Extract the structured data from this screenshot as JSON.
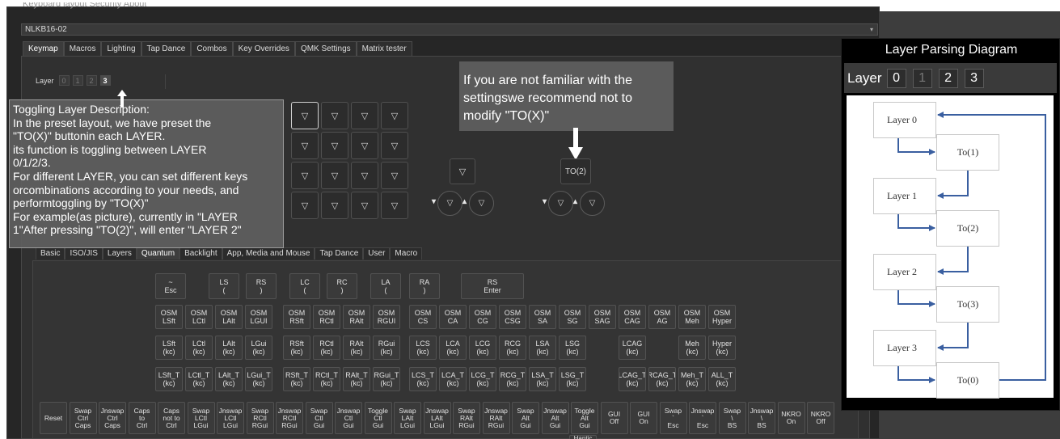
{
  "app": {
    "menu": "Keyboard layout  Security  About",
    "device": "NLKB16-02",
    "main_tabs": [
      "Keymap",
      "Macros",
      "Lighting",
      "Tap Dance",
      "Combos",
      "Key Overrides",
      "QMK Settings",
      "Matrix tester"
    ],
    "active_main_tab": "Keymap"
  },
  "layers": {
    "label": "Layer",
    "buttons": [
      "0",
      "1",
      "2",
      "3"
    ],
    "active": "3"
  },
  "keyboard": {
    "grid_glyph": "▽",
    "encoder_key": "▽",
    "to_key_label": "TO(2)",
    "knob_glyph": "▽",
    "knob_left_arrow": "▾",
    "knob_right_arrow": "▴"
  },
  "annotations": {
    "toggle_desc": [
      "Toggling Layer Description:",
      "In the preset layout, we have preset the",
      "\"TO(X)\"  buttonin each LAYER.",
      "its function is toggling between LAYER",
      "0/1/2/3.",
      "For different LAYER, you can set different keys",
      "orcombinations according to your needs, and",
      "performtoggling by \"TO(X)\"",
      "For example(as picture), currently in \"LAYER",
      "1\"After pressing \"TO(2)\", will enter \"LAYER 2\""
    ],
    "advice": [
      "If you are not familiar with the",
      "settingswe recommend not to",
      "modify \"TO(X)\""
    ]
  },
  "sub_tabs": [
    "Basic",
    "ISO/JIS",
    "Layers",
    "Quantum",
    "Backlight",
    "App, Media and Mouse",
    "Tap Dance",
    "User",
    "Macro"
  ],
  "active_sub_tab": "Quantum",
  "quantum_rows": {
    "row0": [
      "~\nEsc",
      "LS\n(",
      "RS\n)",
      "LC\n(",
      "RC\n)",
      "LA\n(",
      "RA\n)",
      "RS\nEnter"
    ],
    "row1": [
      "OSM\nLSft",
      "OSM\nLCtl",
      "OSM\nLAlt",
      "OSM\nLGUI",
      "OSM\nRSft",
      "OSM\nRCtl",
      "OSM\nRAlt",
      "OSM\nRGUI",
      "OSM\nCS",
      "OSM\nCA",
      "OSM\nCG",
      "OSM\nCSG",
      "OSM\nSA",
      "OSM\nSG",
      "OSM\nSAG",
      "OSM\nCAG",
      "OSM\nAG",
      "OSM\nMeh",
      "OSM\nHyper"
    ],
    "row2": [
      "LSft\n(kc)",
      "LCtl\n(kc)",
      "LAlt\n(kc)",
      "LGui\n(kc)",
      "RSft\n(kc)",
      "RCtl\n(kc)",
      "RAlt\n(kc)",
      "RGui\n(kc)",
      "LCS\n(kc)",
      "LCA\n(kc)",
      "LCG\n(kc)",
      "RCG\n(kc)",
      "LSA\n(kc)",
      "LSG\n(kc)",
      "LCAG\n(kc)",
      "Meh\n(kc)",
      "Hyper\n(kc)"
    ],
    "row3": [
      "LSft_T\n(kc)",
      "LCtl_T\n(kc)",
      "LAlt_T\n(kc)",
      "LGui_T\n(kc)",
      "RSft_T\n(kc)",
      "RCtl_T\n(kc)",
      "RAlt_T\n(kc)",
      "RGui_T\n(kc)",
      "LCS_T\n(kc)",
      "LCA_T\n(kc)",
      "LCG_T\n(kc)",
      "RCG_T\n(kc)",
      "LSA_T\n(kc)",
      "LSG_T\n(kc)",
      "LCAG_T\n(kc)",
      "RCAG_T\n(kc)",
      "Meh_T\n(kc)",
      "ALL_T\n(kc)"
    ],
    "row4": [
      "Reset",
      "Swap\nCtrl\nCaps",
      "Jnswap\nCtrl\nCaps",
      "Caps\nto\nCtrl",
      "Caps\nnot to\nCtrl",
      "Swap\nLCtl\nLGui",
      "Jnswap\nLCtl\nLGui",
      "Swap\nRCtl\nRGui",
      "Jnswap\nRCtl\nRGui",
      "Swap\nCtl\nGui",
      "Jnswap\nCtl\nGui",
      "Toggle\nCtl\nGui",
      "Swap\nLAlt\nLGui",
      "Jnswap\nLAlt\nLGui",
      "Swap\nRAlt\nRGui",
      "Jnswap\nRAlt\nRGui",
      "Swap\nAlt\nGui",
      "Jnswap\nAlt\nGui",
      "Toggle\nAlt\nGui",
      "GUI\nOff",
      "GUI\nOn",
      "Swap\n`\nEsc",
      "Jnswap\n`\nEsc",
      "Swap\n\\\nBS",
      "Jnswap\n\\\nBS",
      "NKRO\nOn",
      "NKRO\nOff"
    ],
    "row5_partial": "Haptic"
  },
  "diagram": {
    "title": "Layer Parsing Diagram",
    "layer_label": "Layer",
    "layer_buttons": [
      "0",
      "1",
      "2",
      "3"
    ],
    "nodes": {
      "layers": [
        "Layer 0",
        "Layer 1",
        "Layer 2",
        "Layer 3"
      ],
      "to": [
        "To(1)",
        "To(2)",
        "To(3)",
        "To(0)"
      ]
    },
    "colors": {
      "arrow": "#3a5fa0",
      "box_border": "#c8c8c8"
    }
  }
}
